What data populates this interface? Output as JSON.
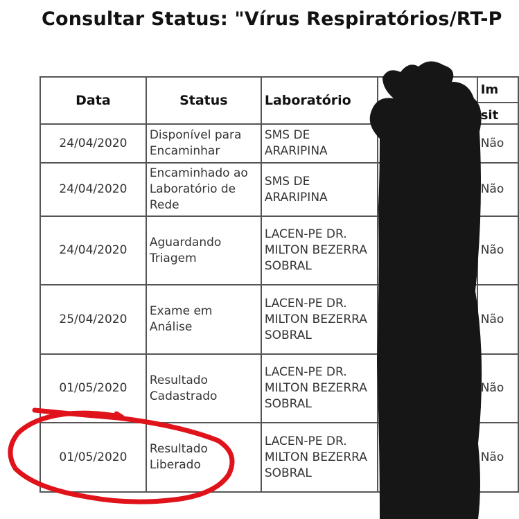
{
  "title": "Consultar Status: \"Vírus Respiratórios/RT-P",
  "table": {
    "headers": {
      "date": "Data",
      "status": "Status",
      "lab": "Laboratório",
      "extra_top": "Im",
      "extra_bottom": "sit"
    },
    "rows": [
      {
        "date": "24/04/2020",
        "status": "Disponível para Encaminhar",
        "lab": "SMS DE ARARIPINA",
        "extra": "Não"
      },
      {
        "date": "24/04/2020",
        "status": "Encaminhado ao Laboratório de Rede",
        "lab": "SMS DE ARARIPINA",
        "extra": "Não"
      },
      {
        "date": "24/04/2020",
        "status": "Aguardando Triagem",
        "lab": "LACEN-PE DR. MILTON BEZERRA SOBRAL",
        "extra": "Não"
      },
      {
        "date": "25/04/2020",
        "status": "Exame em Análise",
        "lab": "LACEN-PE DR. MILTON BEZERRA SOBRAL",
        "extra": "Não"
      },
      {
        "date": "01/05/2020",
        "status": "Resultado Cadastrado",
        "lab": "LACEN-PE DR. MILTON BEZERRA SOBRAL",
        "extra": "Não"
      },
      {
        "date": "01/05/2020",
        "status": "Resultado Liberado",
        "lab": "LACEN-PE DR. MILTON BEZERRA SOBRAL",
        "extra": "Não"
      }
    ]
  },
  "colors": {
    "redaction": "#161616",
    "annotation": "#e0131b",
    "border": "#555555"
  }
}
